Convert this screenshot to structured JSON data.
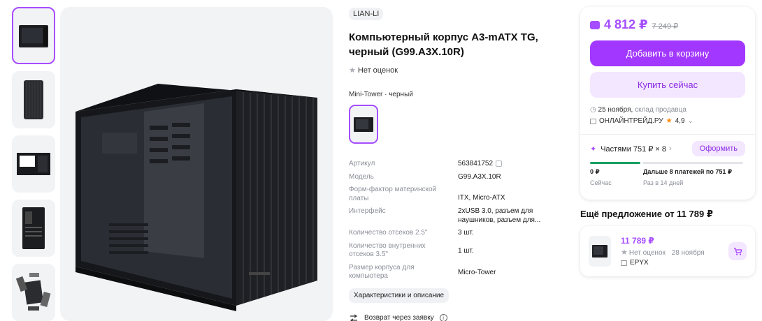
{
  "brand": "LIAN-LI",
  "title": "Компьютерный корпус A3-mATX TG, черный (G99.A3X.10R)",
  "rating_text": "Нет оценок",
  "variant_label": "Mini-Tower · черный",
  "specs": [
    {
      "key": "Артикул",
      "value": "563841752"
    },
    {
      "key": "Модель",
      "value": "G99.A3X.10R"
    },
    {
      "key": "Форм-фактор материнской платы",
      "value": "ITX, Micro-ATX"
    },
    {
      "key": "Интерфейс",
      "value": "2xUSB 3.0, разъем для наушников, разъем для..."
    },
    {
      "key": "Количество отсеков 2.5\"",
      "value": "3 шт."
    },
    {
      "key": "Количество внутренних отсеков 3.5\"",
      "value": "1 шт."
    },
    {
      "key": "Размер корпуса для компьютера",
      "value": "Micro-Tower"
    }
  ],
  "chars_button": "Характеристики и описание",
  "return_text": "Возврат через заявку",
  "buy": {
    "price": "4 812 ₽",
    "old_price": "7 249 ₽",
    "add_to_cart": "Добавить в корзину",
    "buy_now": "Купить сейчас",
    "delivery_date": "25 ноября,",
    "delivery_source": "склад продавца",
    "seller": "ОНЛАЙНТРЕЙД.РУ",
    "seller_rating": "4,9",
    "installments": "Частями 751 ₽ × 8",
    "installments_button": "Оформить",
    "pay_now_value": "0 ₽",
    "pay_now_label": "Сейчас",
    "pay_later_value": "Дальше 8 платежей по 751 ₽",
    "pay_later_label": "Раз в 14 дней"
  },
  "another_offer": {
    "heading": "Ещё предложение от 11 789 ₽",
    "price": "11 789 ₽",
    "rating_text": "Нет оценок",
    "date": "28 ноября",
    "seller": "EPYX"
  },
  "colors": {
    "accent": "#a238ff",
    "accent_light": "#f3e6ff",
    "success": "#19a060"
  }
}
